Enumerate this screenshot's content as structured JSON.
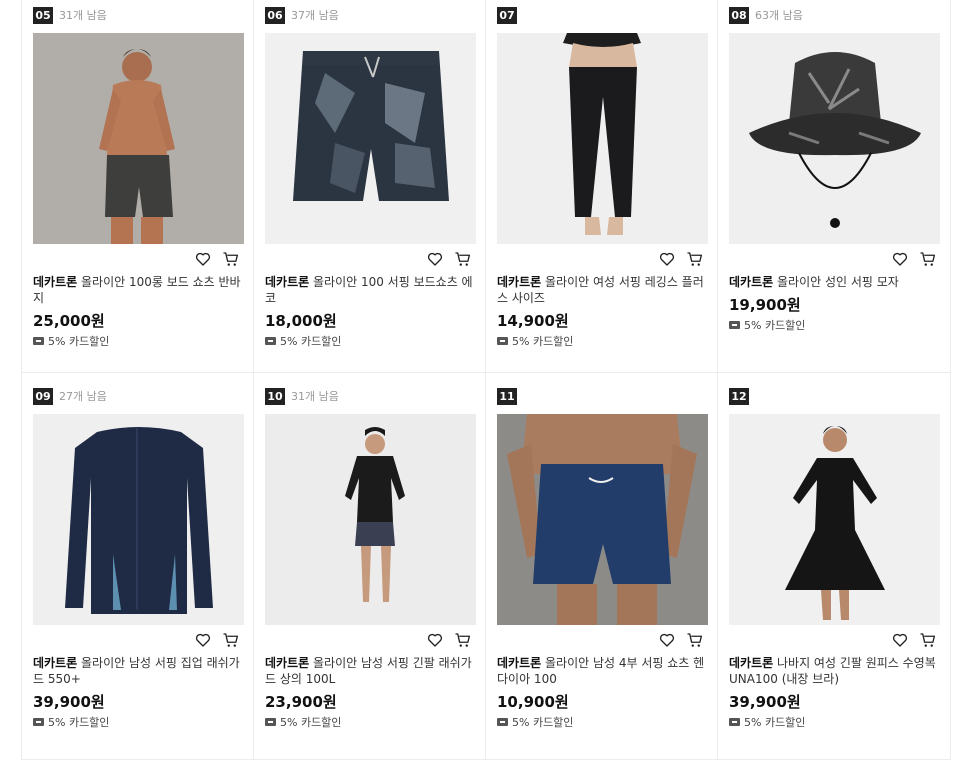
{
  "products": [
    {
      "rank": "05",
      "stock": "31개 남음",
      "brand": "데카트론",
      "name": " 올라이안 100롱 보드 쇼츠 반바지",
      "price": "25,000원",
      "discount": "5% 카드할인",
      "image": "man-board-shorts"
    },
    {
      "rank": "06",
      "stock": "37개 남음",
      "brand": "데카트론",
      "name": " 올라이안 100 서핑 보드쇼츠 에코",
      "price": "18,000원",
      "discount": "5% 카드할인",
      "image": "camo-board-shorts"
    },
    {
      "rank": "07",
      "stock": "",
      "brand": "데카트론",
      "name": " 올라이안 여성 서핑 레깅스 플러스 사이즈",
      "price": "14,900원",
      "discount": "5% 카드할인",
      "image": "surf-leggings"
    },
    {
      "rank": "08",
      "stock": "63개 남음",
      "brand": "데카트론",
      "name": " 올라이안 성인 서핑 모자",
      "price": "19,900원",
      "discount": "5% 카드할인",
      "image": "surf-bucket-hat"
    },
    {
      "rank": "09",
      "stock": "27개 남음",
      "brand": "데카트론",
      "name": " 올라이안 남성 서핑 집업 래쉬가드 550+",
      "price": "39,900원",
      "discount": "5% 카드할인",
      "image": "zip-rashguard"
    },
    {
      "rank": "10",
      "stock": "31개 남음",
      "brand": "데카트론",
      "name": " 올라이안 남성 서핑 긴팔 래쉬가드 상의 100L",
      "price": "23,900원",
      "discount": "5% 카드할인",
      "image": "man-rashguard"
    },
    {
      "rank": "11",
      "stock": "",
      "brand": "데카트론",
      "name": " 올라이안 남성 4부 서핑 쇼츠 헨다이아 100",
      "price": "10,900원",
      "discount": "5% 카드할인",
      "image": "navy-shorts"
    },
    {
      "rank": "12",
      "stock": "",
      "brand": "데카트론",
      "name": " 나바지 여성 긴팔 원피스 수영복 UNA100 (내장 브라)",
      "price": "39,900원",
      "discount": "5% 카드할인",
      "image": "woman-swim-dress"
    }
  ],
  "icons": {
    "wishlist": "heart-icon",
    "cart": "cart-icon",
    "discount": "card-discount-icon"
  },
  "colors": {
    "rank_badge": "#222222",
    "card_border": "#ececec",
    "thumb_bg": "#efefef"
  }
}
